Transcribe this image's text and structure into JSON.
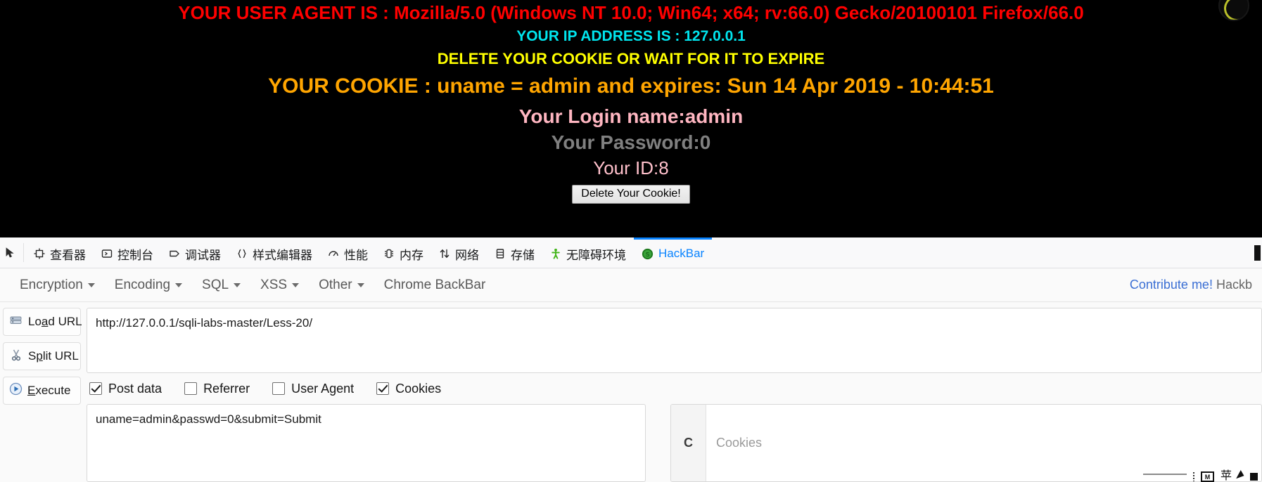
{
  "page": {
    "user_agent_line": "YOUR USER AGENT IS : Mozilla/5.0 (Windows NT 10.0; Win64; x64; rv:66.0) Gecko/20100101 Firefox/66.0",
    "ip_line": "YOUR IP ADDRESS IS : 127.0.0.1",
    "delete_notice": "DELETE YOUR COOKIE OR WAIT FOR IT TO EXPIRE",
    "cookie_line": "YOUR COOKIE : uname = admin and expires: Sun 14 Apr 2019 - 10:44:51",
    "login_name": "Your Login name:admin",
    "password": "Your Password:0",
    "id": "Your ID:8",
    "delete_button": "Delete Your Cookie!",
    "colors": {
      "user_agent": "#FF0000",
      "ip": "#00E5EE",
      "delete_notice": "#FFFF00",
      "cookie": "#FFA500",
      "login_name": "#FFB6C1",
      "password": "#808080",
      "id": "#FFC0CB",
      "background": "#000000"
    }
  },
  "devtools": {
    "picker_icon": "element-picker-icon",
    "tabs": [
      {
        "label": "查看器",
        "icon": "inspector-icon",
        "active": false
      },
      {
        "label": "控制台",
        "icon": "console-icon",
        "active": false
      },
      {
        "label": "调试器",
        "icon": "debugger-icon",
        "active": false
      },
      {
        "label": "样式编辑器",
        "icon": "style-editor-icon",
        "active": false
      },
      {
        "label": "性能",
        "icon": "performance-icon",
        "active": false
      },
      {
        "label": "内存",
        "icon": "memory-icon",
        "active": false
      },
      {
        "label": "网络",
        "icon": "network-icon",
        "active": false
      },
      {
        "label": "存储",
        "icon": "storage-icon",
        "active": false
      },
      {
        "label": "无障碍环境",
        "icon": "accessibility-icon",
        "active": false
      },
      {
        "label": "HackBar",
        "icon": "hackbar-icon",
        "active": true
      }
    ],
    "active_tab_color": "#0a84ff"
  },
  "hackbar": {
    "menu": [
      {
        "label": "Encryption",
        "has_caret": true
      },
      {
        "label": "Encoding",
        "has_caret": true
      },
      {
        "label": "SQL",
        "has_caret": true
      },
      {
        "label": "XSS",
        "has_caret": true
      },
      {
        "label": "Other",
        "has_caret": true
      },
      {
        "label": "Chrome BackBar",
        "has_caret": false
      }
    ],
    "contribute_link": "Contribute me!",
    "contribute_suffix": "Hackb",
    "actions": [
      {
        "label_pre": "Lo",
        "label_key": "a",
        "label_post": "d URL",
        "icon": "load-url-icon"
      },
      {
        "label_pre": "S",
        "label_key": "p",
        "label_post": "lit URL",
        "icon": "split-url-icon"
      },
      {
        "label_pre": "",
        "label_key": "E",
        "label_post": "xecute",
        "icon": "execute-icon"
      }
    ],
    "url_value": "http://127.0.0.1/sqli-labs-master/Less-20/",
    "checkboxes": [
      {
        "label": "Post data",
        "checked": true
      },
      {
        "label": "Referrer",
        "checked": false
      },
      {
        "label": "User Agent",
        "checked": false
      },
      {
        "label": "Cookies",
        "checked": true
      }
    ],
    "post_data_value": "uname=admin&passwd=0&submit=Submit",
    "cookie_prefix": "C",
    "cookie_placeholder": "Cookies",
    "cookie_value": ""
  }
}
